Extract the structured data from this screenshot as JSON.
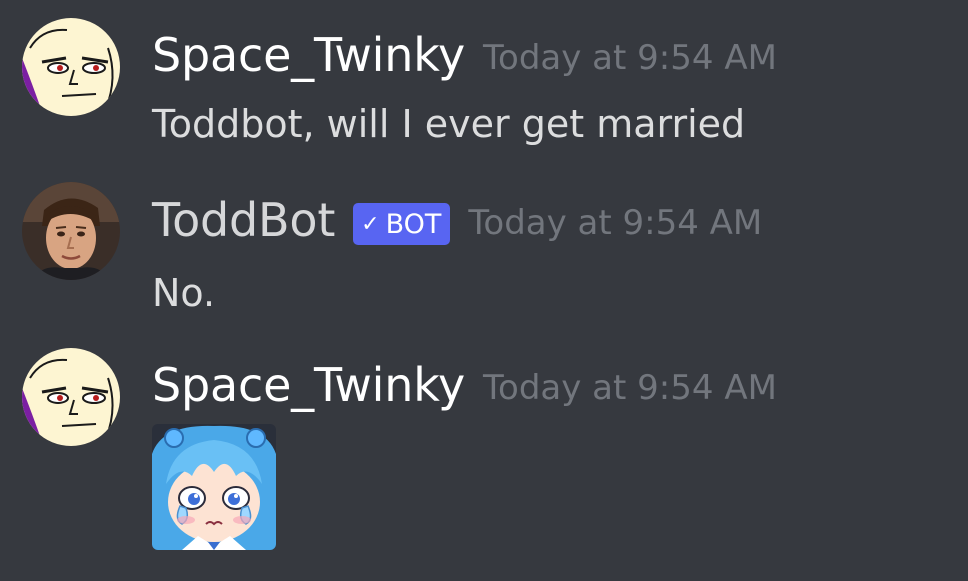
{
  "messages": [
    {
      "author": "Space_Twinky",
      "timestamp": "Today at 9:54 AM",
      "text": "Toddbot, will I ever get married",
      "avatar_icon": "bald-face-avatar"
    },
    {
      "author": "ToddBot",
      "timestamp": "Today at 9:54 AM",
      "badge": "BOT",
      "badge_check": "✓",
      "text": "No.",
      "avatar_icon": "man-portrait-avatar"
    },
    {
      "author": "Space_Twinky",
      "timestamp": "Today at 9:54 AM",
      "emote_icon": "crying-anime-girl-emote",
      "avatar_icon": "bald-face-avatar"
    }
  ],
  "colors": {
    "background": "#36393f",
    "username": "#ffffff",
    "timestamp": "#72767d",
    "message_text": "#dcddde",
    "bot_badge": "#5865f2"
  }
}
